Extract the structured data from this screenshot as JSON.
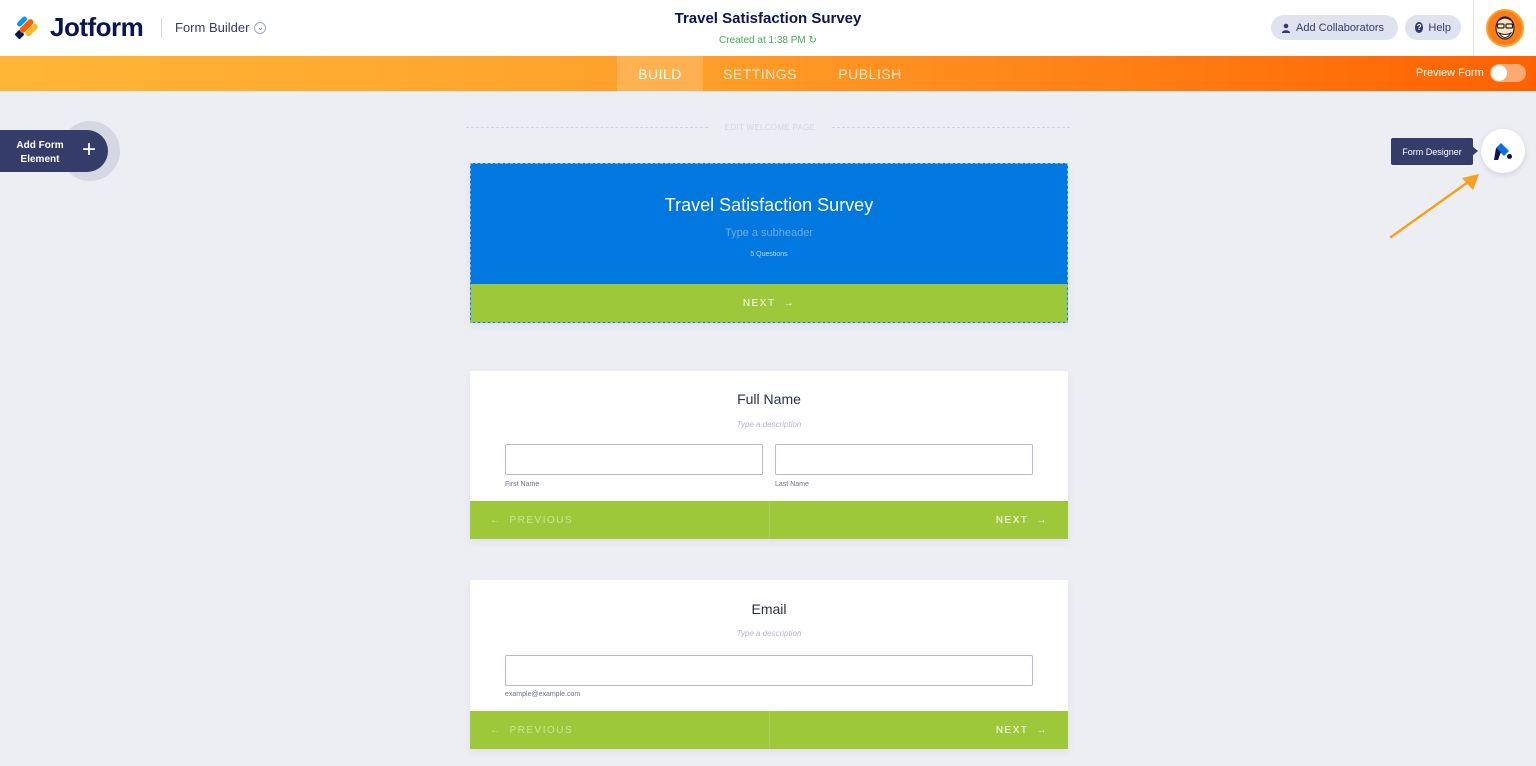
{
  "header": {
    "brand": "Jotform",
    "builder_menu": "Form Builder",
    "form_title": "Travel Satisfaction Survey",
    "created": "Created at 1:38 PM",
    "collaborators_label": "Add Collaborators",
    "help_label": "Help"
  },
  "nav": {
    "tabs": [
      {
        "label": "BUILD",
        "active": true
      },
      {
        "label": "SETTINGS",
        "active": false
      },
      {
        "label": "PUBLISH",
        "active": false
      }
    ],
    "preview_label": "Preview Form",
    "preview_on": false
  },
  "sidebar": {
    "add_element_label": "Add Form Element"
  },
  "designer": {
    "tooltip": "Form Designer"
  },
  "welcome": {
    "edit_label": "EDIT WELCOME PAGE",
    "title": "Travel Satisfaction Survey",
    "subheader_placeholder": "Type a subheader",
    "questions_count": "5 Questions",
    "next_label": "NEXT"
  },
  "questions": [
    {
      "title": "Full Name",
      "description_placeholder": "Type a description",
      "sublabels": [
        "First Name",
        "Last Name"
      ],
      "previous_label": "PREVIOUS",
      "next_label": "NEXT"
    },
    {
      "title": "Email",
      "description_placeholder": "Type a description",
      "sublabels": [
        "example@example.com"
      ],
      "previous_label": "PREVIOUS",
      "next_label": "NEXT"
    }
  ],
  "colors": {
    "brand_navy": "#0a1551",
    "accent_orange": "#ff6100",
    "header_blue": "#0078e0",
    "button_green": "#9dc83a"
  }
}
